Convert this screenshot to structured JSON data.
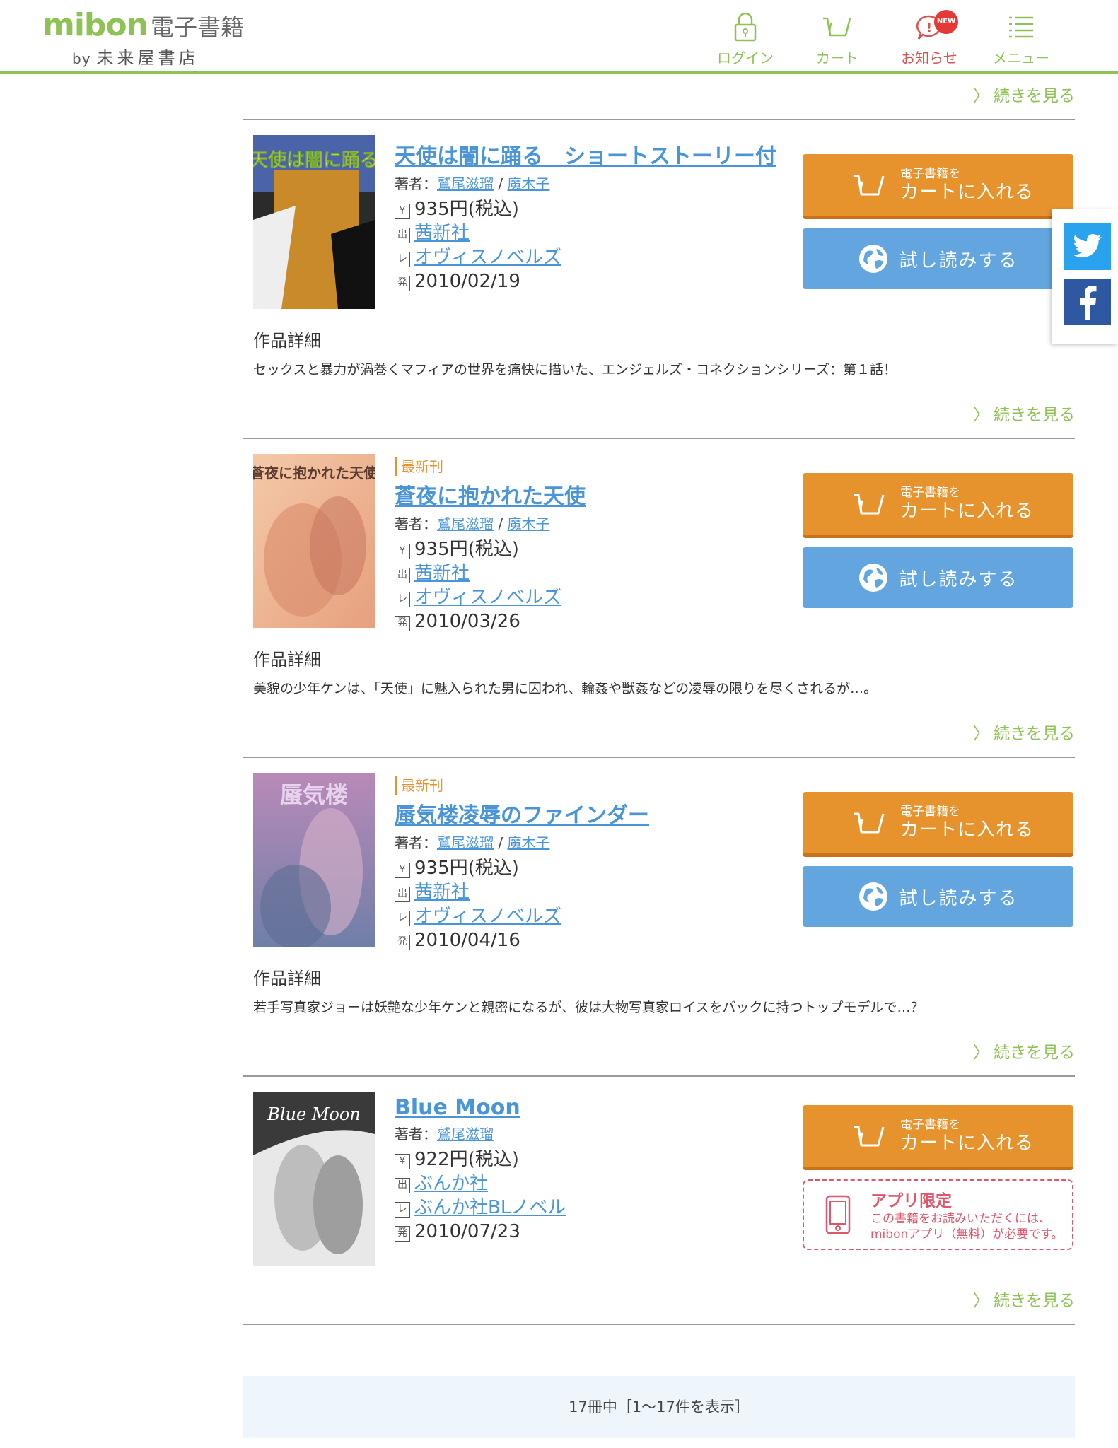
{
  "header": {
    "logo_main": "mibon",
    "logo_sub": "電子書籍",
    "logo_by": "by",
    "logo_store": "未来屋書店",
    "nav": [
      {
        "label": "ログイン",
        "icon": "lock-icon"
      },
      {
        "label": "カート",
        "icon": "cart-icon"
      },
      {
        "label": "お知らせ",
        "icon": "notice-icon",
        "badge": "NEW"
      },
      {
        "label": "メニュー",
        "icon": "menu-icon"
      }
    ]
  },
  "more_label": "続きを見る",
  "labels": {
    "author_prefix": "著者：",
    "detail_heading": "作品詳細",
    "cart_small": "電子書籍を",
    "cart_main": "カートに入れる",
    "trial": "試し読みする",
    "new_badge": "最新刊",
    "app_only_title": "アプリ限定",
    "app_only_desc1": "この書籍をお読みいただくには、",
    "app_only_desc2": "mibonアプリ（無料）が必要です。",
    "mark_price": "¥",
    "mark_publisher": "出",
    "mark_label": "レ",
    "mark_date": "発"
  },
  "books": [
    {
      "title": "天使は闇に踊る　ショートストーリー付",
      "is_new": false,
      "authors": [
        "鷲尾滋瑠",
        "魔木子"
      ],
      "price": "935円(税込)",
      "publisher": "茜新社",
      "label": "オヴィスノベルズ",
      "date": "2010/02/19",
      "detail": "セックスと暴力が渦巻くマフィアの世界を痛快に描いた、エンジェルズ・コネクションシリーズ：第１話！",
      "cover_text": "天使は闇に踊る",
      "has_trial": true
    },
    {
      "title": "蒼夜に抱かれた天使",
      "is_new": true,
      "authors": [
        "鷲尾滋瑠",
        "魔木子"
      ],
      "price": "935円(税込)",
      "publisher": "茜新社",
      "label": "オヴィスノベルズ",
      "date": "2010/03/26",
      "detail": "美貌の少年ケンは、「天使」に魅入られた男に囚われ、輪姦や獣姦などの凌辱の限りを尽くされるが…。",
      "cover_text": "蒼夜に抱かれた天使",
      "has_trial": true
    },
    {
      "title": "蜃気楼凌辱のファインダー",
      "is_new": true,
      "authors": [
        "鷲尾滋瑠",
        "魔木子"
      ],
      "price": "935円(税込)",
      "publisher": "茜新社",
      "label": "オヴィスノベルズ",
      "date": "2010/04/16",
      "detail": "若手写真家ジョーは妖艶な少年ケンと親密になるが、彼は大物写真家ロイスをバックに持つトップモデルで…？",
      "cover_text": "蜃気楼",
      "has_trial": true
    },
    {
      "title": "Blue Moon",
      "is_new": false,
      "authors": [
        "鷲尾滋瑠"
      ],
      "price": "922円(税込)",
      "publisher": "ぶんか社",
      "label": "ぶんか社BLノベル",
      "date": "2010/07/23",
      "detail": "",
      "cover_text": "Blue Moon",
      "has_trial": false
    }
  ],
  "footer": {
    "count_text": "17冊中［1〜17件を表示］"
  },
  "social": [
    {
      "name": "twitter",
      "color": "#2aa3ef"
    },
    {
      "name": "facebook",
      "color": "#2f58a3"
    }
  ],
  "colors": {
    "brand_green": "#8ec255",
    "cart_orange": "#e6932e",
    "trial_blue": "#63a6df",
    "link_blue": "#4a95d8",
    "app_only_red": "#e0566a"
  }
}
